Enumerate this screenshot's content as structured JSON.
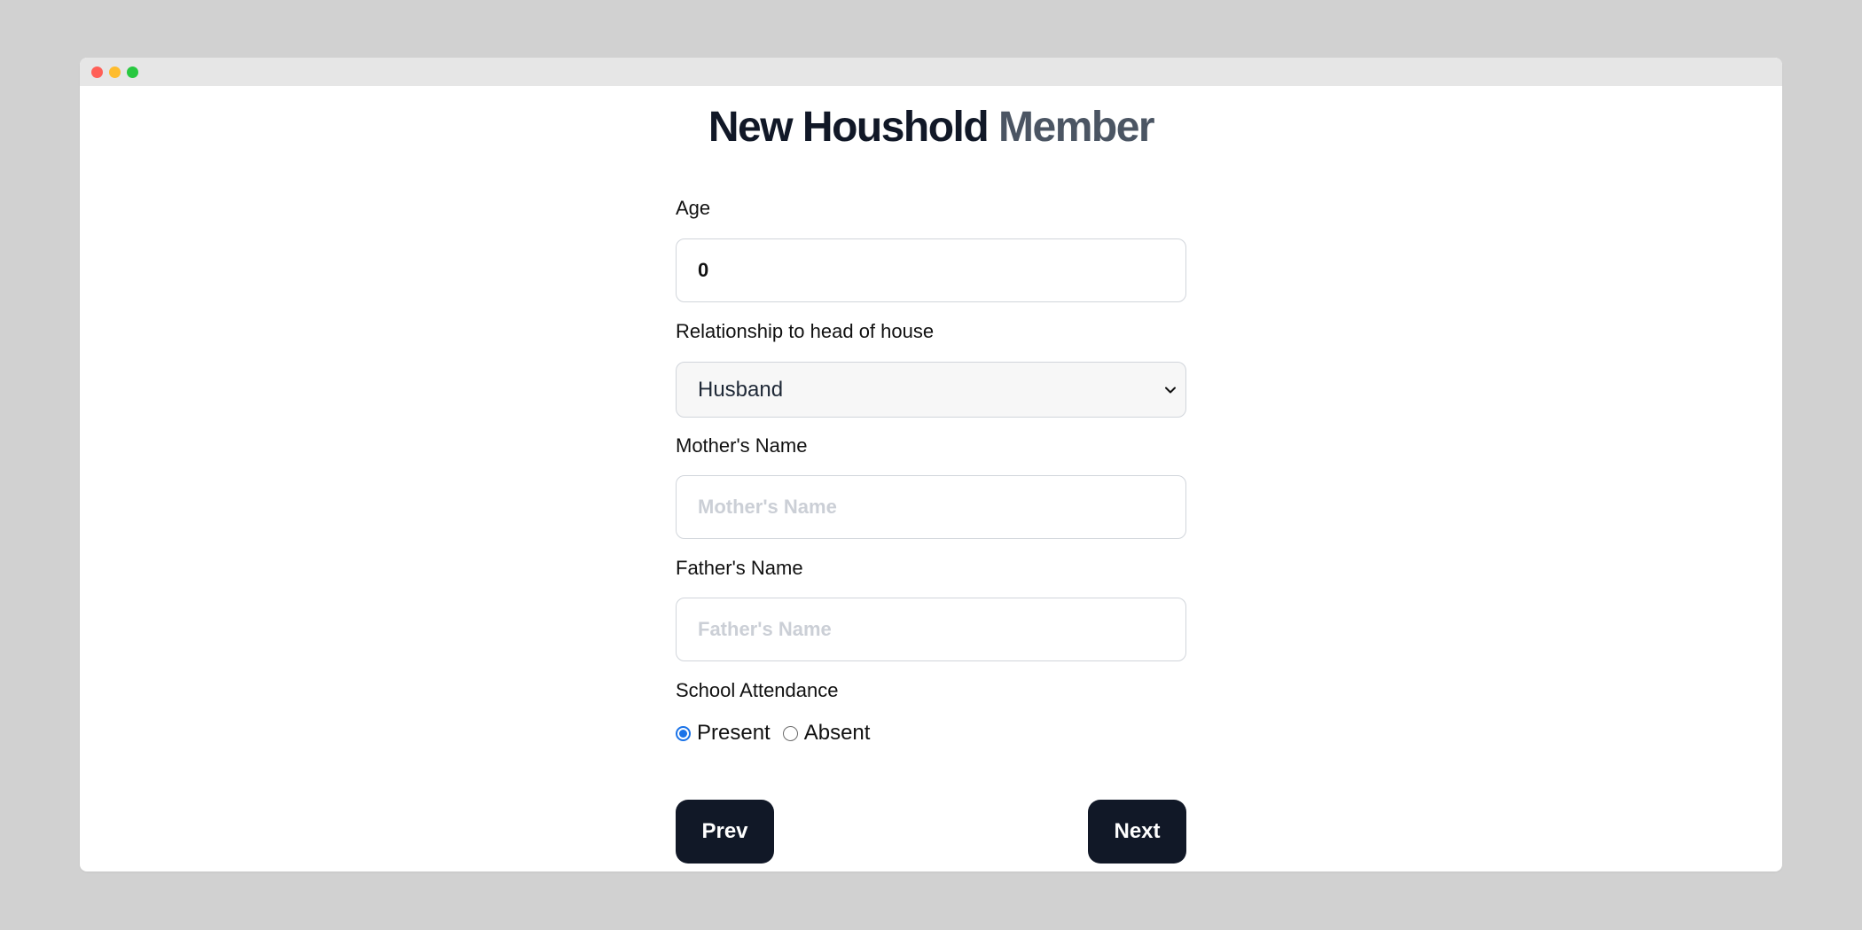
{
  "page": {
    "title_main": "New Houshold",
    "title_accent": "Member"
  },
  "form": {
    "age": {
      "label": "Age",
      "value": "0"
    },
    "relationship": {
      "label": "Relationship to head of house",
      "selected": "Husband"
    },
    "mother": {
      "label": "Mother's Name",
      "placeholder": "Mother's Name",
      "value": ""
    },
    "father": {
      "label": "Father's Name",
      "placeholder": "Father's Name",
      "value": ""
    },
    "attendance": {
      "label": "School Attendance",
      "options": [
        {
          "label": "Present",
          "checked": true
        },
        {
          "label": "Absent",
          "checked": false
        }
      ]
    }
  },
  "buttons": {
    "prev": "Prev",
    "next": "Next"
  },
  "colors": {
    "primary_button": "#111827",
    "title_accent": "#4b5563",
    "radio_checked": "#1a73e8"
  }
}
